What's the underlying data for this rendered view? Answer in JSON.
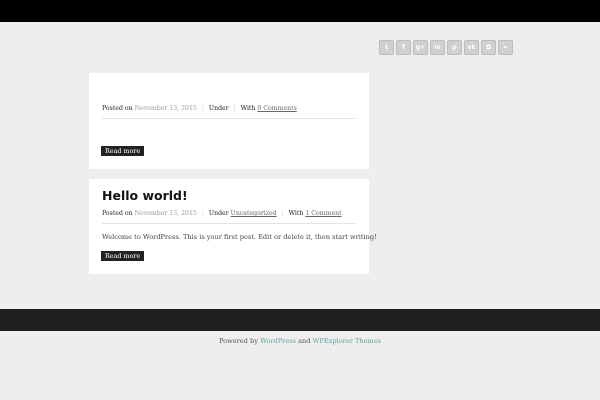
{
  "social": [
    {
      "icon": "twitter-icon",
      "glyph": "t"
    },
    {
      "icon": "facebook-icon",
      "glyph": "f"
    },
    {
      "icon": "google-plus-icon",
      "glyph": "g+"
    },
    {
      "icon": "linkedin-icon",
      "glyph": "in"
    },
    {
      "icon": "pinterest-icon",
      "glyph": "p"
    },
    {
      "icon": "vk-icon",
      "glyph": "vk"
    },
    {
      "icon": "instagram-icon",
      "glyph": "◘"
    },
    {
      "icon": "rss-icon",
      "glyph": "≈"
    }
  ],
  "posts": [
    {
      "title": "",
      "posted_label": "Posted on",
      "date": "November 13, 2015",
      "under_label": "Under",
      "category": "",
      "with_label": "With",
      "comments": "0 Comments",
      "excerpt": "",
      "read_more": "Read more"
    },
    {
      "title": "Hello world!",
      "posted_label": "Posted on",
      "date": "November 13, 2015",
      "under_label": "Under",
      "category": "Uncategorized",
      "with_label": "With",
      "comments": "1 Comment",
      "excerpt": "Welcome to WordPress. This is your first post. Edit or delete it, then start writing!",
      "read_more": "Read more"
    }
  ],
  "footer": {
    "powered_by": "Powered by",
    "wordpress": "WordPress",
    "and": "and",
    "wpexplorer": "WPExplorer Themes"
  },
  "colors": {
    "accent": "#5fa59b",
    "top_bar": "#000000",
    "footer_bar": "#1f1f1f",
    "background": "#eeeeee"
  }
}
